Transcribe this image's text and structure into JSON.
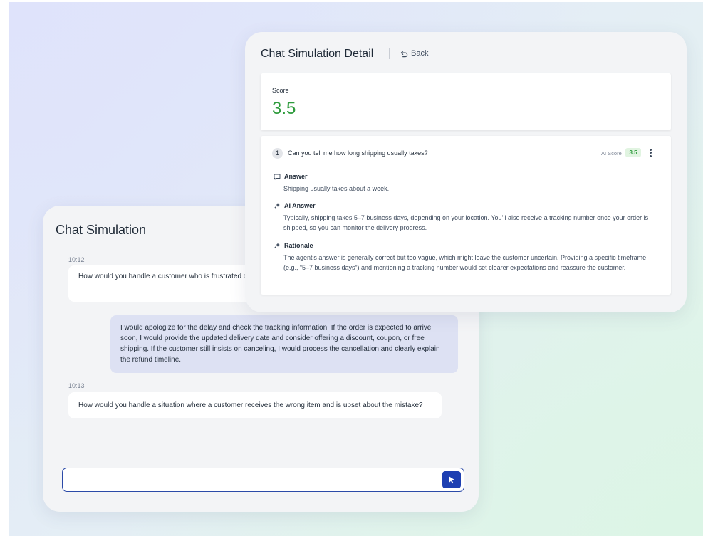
{
  "chat": {
    "title": "Chat Simulation",
    "messages": [
      {
        "time": "10:12",
        "role": "customer",
        "text": "How would you handle a customer who is frustrated order?"
      },
      {
        "role": "agent",
        "text": "I would apologize for the delay and check the tracking information. If the order is expected to arrive soon, I would provide the updated delivery date and consider offering a discount, coupon, or free shipping. If the customer still insists on canceling, I would process the cancellation and clearly explain the refund timeline."
      },
      {
        "time": "10:13",
        "role": "customer",
        "text": "How would you handle a situation where a customer receives the wrong item and is upset about the mistake?"
      }
    ],
    "input": {
      "value": "",
      "placeholder": ""
    },
    "send_icon": "cursor-arrow-icon",
    "accent_color": "#1d3fb2"
  },
  "detail": {
    "title": "Chat Simulation Detail",
    "back_label": "Back",
    "score_label": "Score",
    "score_value": "3.5",
    "score_color": "#2e9b3c",
    "question": {
      "number": "1",
      "text": "Can you tell me how long shipping usually takes?",
      "ai_score_label": "AI Score",
      "ai_score": "3.5",
      "answer_label": "Answer",
      "answer": "Shipping usually takes about a week.",
      "ai_answer_label": "AI Answer",
      "ai_answer": "Typically, shipping takes 5–7 business days, depending on your location. You’ll also receive a tracking number once your order is shipped, so you can monitor the delivery progress.",
      "rationale_label": "Rationale",
      "rationale": "The agent’s answer is generally correct but too vague, which might leave the customer uncertain. Providing a specific timeframe (e.g., “5–7 business days”) and mentioning a tracking number would set clearer expectations and reassure the customer."
    }
  }
}
